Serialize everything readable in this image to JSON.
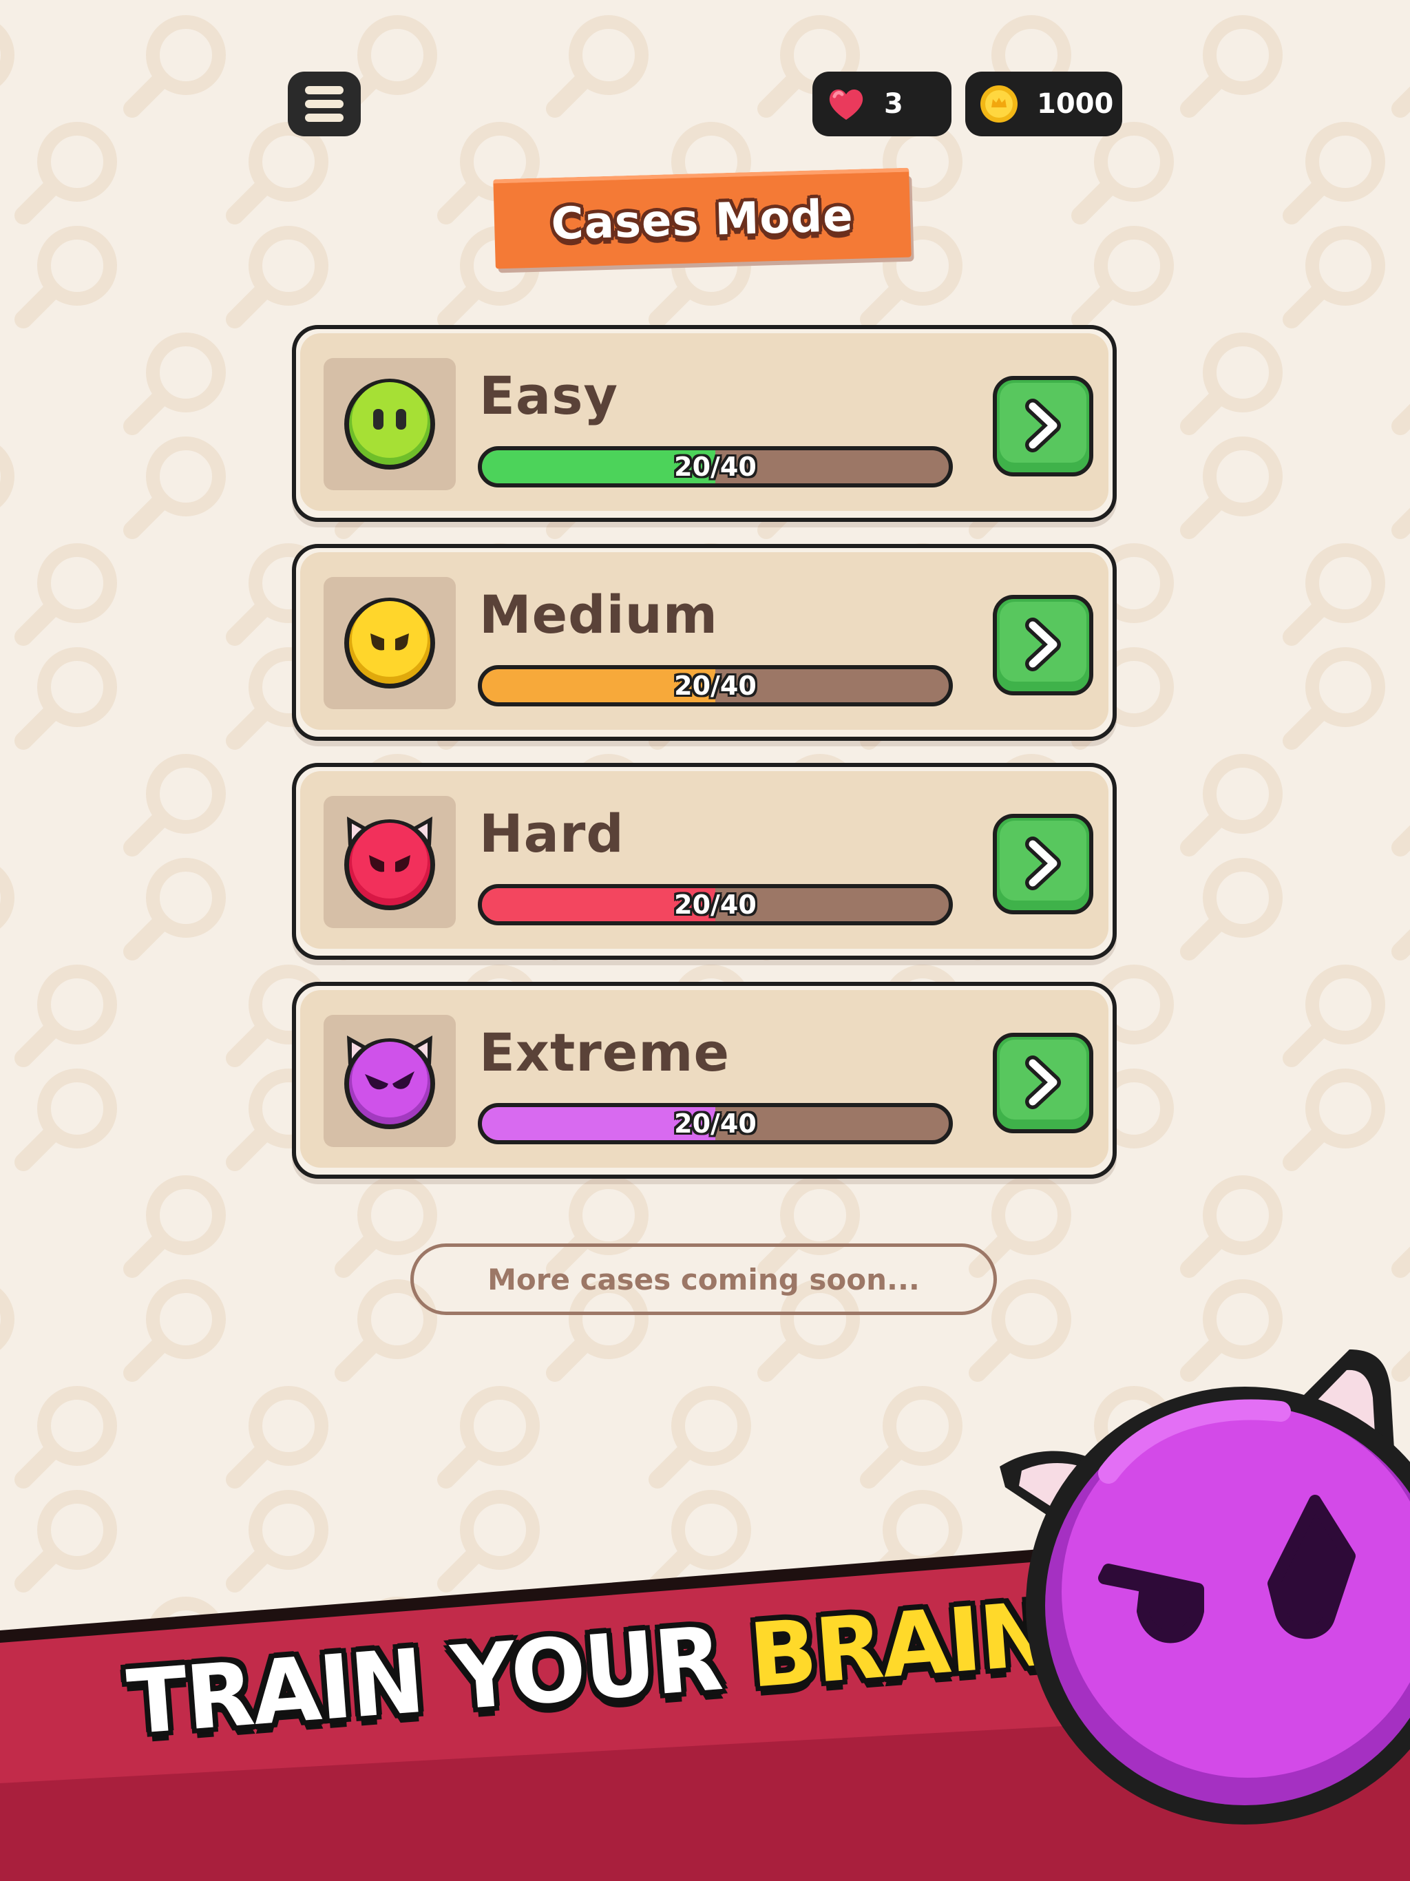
{
  "header": {
    "lives": "3",
    "coins": "1000"
  },
  "title": "Cases Mode",
  "levels": [
    {
      "name": "Easy",
      "progress": "20/40",
      "fraction": 0.5,
      "color": "#4cd35a"
    },
    {
      "name": "Medium",
      "progress": "20/40",
      "fraction": 0.5,
      "color": "#f7a93a"
    },
    {
      "name": "Hard",
      "progress": "20/40",
      "fraction": 0.5,
      "color": "#f3465f"
    },
    {
      "name": "Extreme",
      "progress": "20/40",
      "fraction": 0.5,
      "color": "#d86af0"
    }
  ],
  "coming_soon": "More cases coming soon...",
  "promo": {
    "part1": "TRAIN YOUR",
    "part2": "BRAIN"
  },
  "colors": {
    "background": "#f6efe6",
    "accent_orange": "#f47a36",
    "go_green": "#58c75e",
    "band_red": "#c22b4a",
    "promo_yellow": "#ffd92a"
  },
  "icons": [
    "menu-icon",
    "heart-icon",
    "coin-icon",
    "chevron-right-icon",
    "magnifier-icon"
  ]
}
